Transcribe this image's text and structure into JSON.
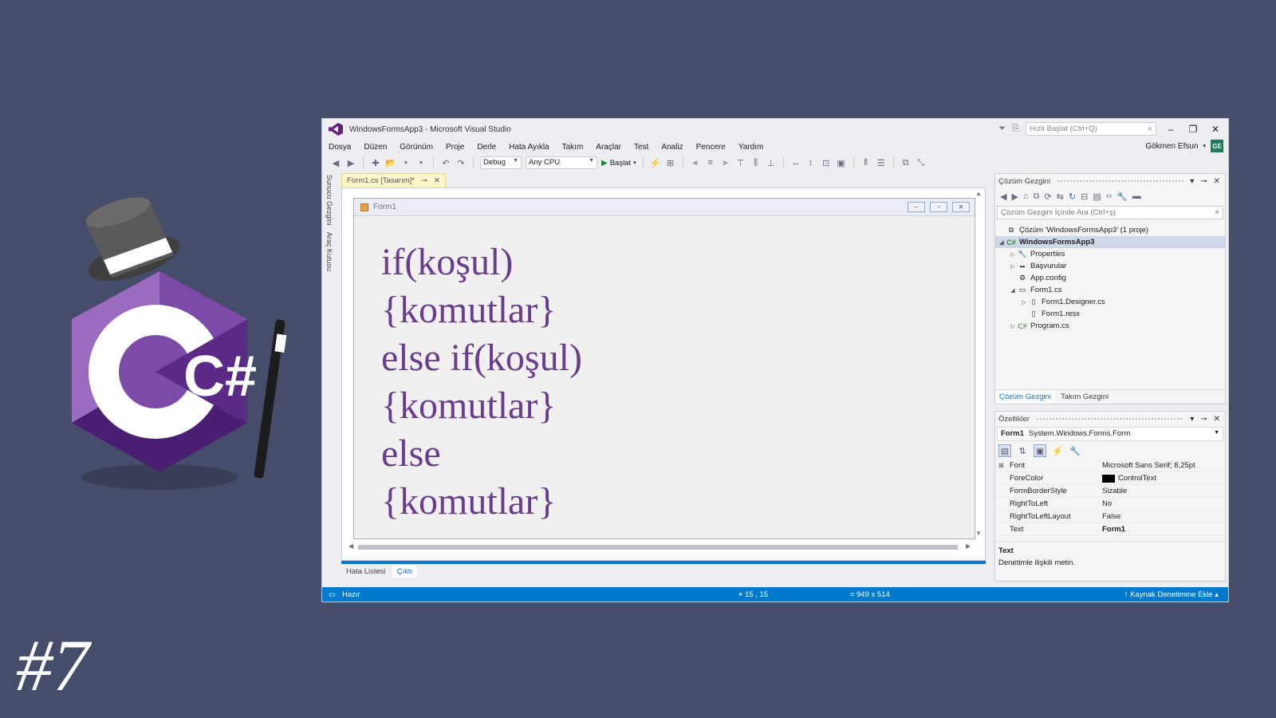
{
  "episode_label": "#7",
  "logo": {
    "text": "C#",
    "colors": {
      "hex_dark": "#5b2a86",
      "hex_mid": "#7e4aa8",
      "hex_light": "#9b6bc0",
      "hat": "#555555"
    }
  },
  "window": {
    "title": "WindowsFormsApp3 - Microsoft Visual Studio",
    "quick_launch_placeholder": "Hızlı Başlat (Ctrl+Q)",
    "user_name": "Gökmen Efsun",
    "user_initials": "GE",
    "menu": [
      "Dosya",
      "Düzen",
      "Görünüm",
      "Proje",
      "Derle",
      "Hata Ayıkla",
      "Takım",
      "Araçlar",
      "Test",
      "Analiz",
      "Pencere",
      "Yardım"
    ],
    "toolbar": {
      "config": "Debug",
      "platform": "Any CPU",
      "run_label": "Başlat"
    },
    "side_tabs": [
      "Sunucu Gezgini",
      "Araç Kutusu"
    ],
    "doc_tab": "Form1.cs [Tasarım]*",
    "form_title": "Form1",
    "code_lines": [
      "if(koşul)",
      "{komutlar}",
      "else if(koşul)",
      "{komutlar}",
      "else",
      "{komutlar}"
    ],
    "bottom_tabs": [
      "Hata Listesi",
      "Çıktı"
    ],
    "solution_explorer": {
      "title": "Çözüm Gezgini",
      "search_placeholder": "Çözüm Gezgini İçinde Ara (Ctrl+ş)",
      "items": [
        {
          "label": "Çözüm 'WindowsFormsApp3' (1 proje)",
          "icon": "solution-icon",
          "expander": ""
        },
        {
          "label": "WindowsFormsApp3",
          "icon": "csharp-project-icon",
          "expander": "◢"
        },
        {
          "label": "Properties",
          "icon": "wrench-icon",
          "expander": "▷"
        },
        {
          "label": "Başvurular",
          "icon": "references-icon",
          "expander": "▷"
        },
        {
          "label": "App.config",
          "icon": "config-file-icon",
          "expander": ""
        },
        {
          "label": "Form1.cs",
          "icon": "form-icon",
          "expander": "◢"
        },
        {
          "label": "Form1.Designer.cs",
          "icon": "cs-file-icon",
          "expander": "▷"
        },
        {
          "label": "Form1.resx",
          "icon": "resx-file-icon",
          "expander": ""
        },
        {
          "label": "Program.cs",
          "icon": "cs-file-icon",
          "expander": "▷"
        }
      ],
      "tabs": [
        "Çözüm Gezgini",
        "Takım Gezgini"
      ]
    },
    "properties": {
      "title": "Özellikler",
      "object_name": "Form1",
      "object_type": "System.Windows.Forms.Form",
      "rows": [
        {
          "name": "Font",
          "value": "Microsoft Sans Serif; 8,25pt"
        },
        {
          "name": "ForeColor",
          "value": "ControlText"
        },
        {
          "name": "FormBorderStyle",
          "value": "Sizable"
        },
        {
          "name": "RightToLeft",
          "value": "No"
        },
        {
          "name": "RightToLeftLayout",
          "value": "False"
        },
        {
          "name": "Text",
          "value": "Form1"
        }
      ],
      "desc_title": "Text",
      "desc_text": "Denetimle ilişkili metin."
    },
    "status": {
      "ready": "Hazır",
      "position": "15 , 15",
      "size": "949 x 514",
      "scm": "Kaynak Denetimine Ekle"
    }
  }
}
